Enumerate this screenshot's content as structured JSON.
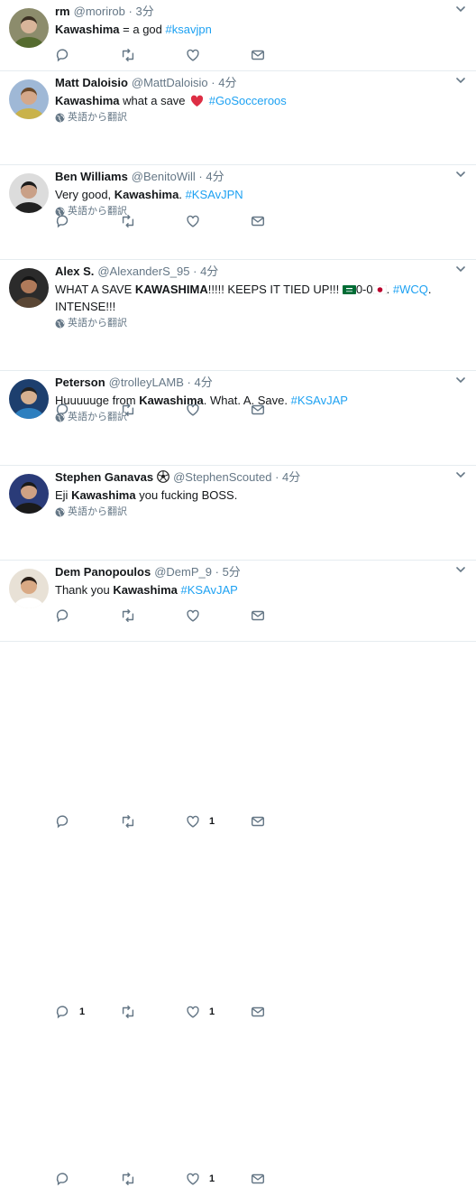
{
  "translate_label": "英語から翻訳",
  "colors": {
    "link": "#1da1f2",
    "muted": "#657786",
    "border": "#e6ecf0",
    "heart": "#e0245e"
  },
  "tweets": [
    {
      "name": "rm",
      "handle": "@morirob",
      "dot": "·",
      "time": "3分",
      "segments": [
        {
          "type": "bold",
          "text": "Kawashima"
        },
        {
          "type": "text",
          "text": " = a god "
        },
        {
          "type": "hashtag",
          "text": "#ksavjpn"
        }
      ],
      "translate": false,
      "reply_count": "",
      "like_count": ""
    },
    {
      "name": "Matt Daloisio",
      "handle": "@MattDaloisio",
      "dot": "·",
      "time": "4分",
      "segments": [
        {
          "type": "bold",
          "text": "Kawashima"
        },
        {
          "type": "text",
          "text": " what a save "
        },
        {
          "type": "emoji",
          "icon": "red-heart-emoji"
        },
        {
          "type": "text",
          "text": " "
        },
        {
          "type": "hashtag",
          "text": "#GoSocceroos"
        }
      ],
      "translate": true,
      "reply_count": "",
      "like_count": ""
    },
    {
      "name": "Ben Williams",
      "handle": "@BenitoWill",
      "dot": "·",
      "time": "4分",
      "segments": [
        {
          "type": "text",
          "text": "Very good, "
        },
        {
          "type": "bold",
          "text": "Kawashima"
        },
        {
          "type": "text",
          "text": ". "
        },
        {
          "type": "hashtag",
          "text": "#KSAvJPN"
        }
      ],
      "translate": true,
      "reply_count": "",
      "like_count": ""
    },
    {
      "name": "Alex S.",
      "handle": "@AlexanderS_95",
      "dot": "·",
      "time": "4分",
      "segments": [
        {
          "type": "text",
          "text": "WHAT A SAVE "
        },
        {
          "type": "bold",
          "text": "KAWASHIMA"
        },
        {
          "type": "text",
          "text": "!!!!! KEEPS IT TIED UP!!! "
        },
        {
          "type": "emoji",
          "icon": "saudi-flag-emoji"
        },
        {
          "type": "text",
          "text": "0-0"
        },
        {
          "type": "emoji",
          "icon": "japan-flag-emoji"
        },
        {
          "type": "text",
          "text": ". "
        },
        {
          "type": "hashtag",
          "text": "#WCQ"
        },
        {
          "type": "text",
          "text": ". INTENSE!!!"
        }
      ],
      "translate": true,
      "reply_count": "",
      "like_count": ""
    },
    {
      "name": "Peterson",
      "handle": "@trolleyLAMB",
      "dot": "·",
      "time": "4分",
      "segments": [
        {
          "type": "text",
          "text": "Huuuuuge from "
        },
        {
          "type": "bold",
          "text": "Kawashima"
        },
        {
          "type": "text",
          "text": ". What. A. Save. "
        },
        {
          "type": "hashtag",
          "text": "#KSAvJAP"
        }
      ],
      "translate": true,
      "reply_count": "",
      "like_count": "1"
    },
    {
      "name": "Stephen Ganavas",
      "name_emoji": "soccer-ball-emoji",
      "handle": "@StephenScouted",
      "dot": "·",
      "time": "4分",
      "segments": [
        {
          "type": "text",
          "text": "Eji "
        },
        {
          "type": "bold",
          "text": "Kawashima"
        },
        {
          "type": "text",
          "text": " you fucking BOSS."
        }
      ],
      "translate": true,
      "reply_count": "1",
      "like_count": "1"
    },
    {
      "name": "Dem Panopoulos",
      "handle": "@DemP_9",
      "dot": "·",
      "time": "5分",
      "segments": [
        {
          "type": "text",
          "text": "Thank you "
        },
        {
          "type": "bold",
          "text": "Kawashima"
        },
        {
          "type": "text",
          "text": " "
        },
        {
          "type": "hashtag",
          "text": "#KSAvJAP"
        }
      ],
      "translate": false,
      "reply_count": "",
      "like_count": "1"
    }
  ]
}
